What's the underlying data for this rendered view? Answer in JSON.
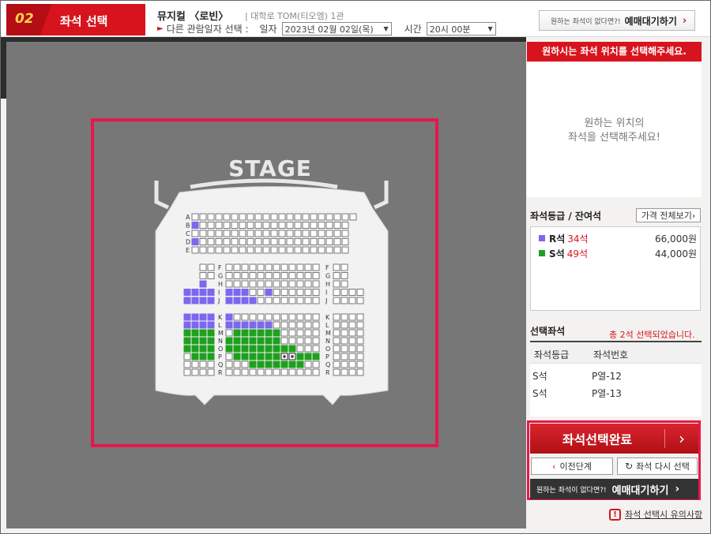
{
  "header": {
    "step_number": "02",
    "step_title": "좌석 선택",
    "show_title": "뮤지컬 〈로빈〉",
    "venue": "| 대학로 TOM(티오엠) 1관",
    "alt_date_label": "다른 관람일자 선택 :",
    "date_label": "일자",
    "date_value": "2023년 02월 02일(목)",
    "time_label": "시간",
    "time_value": "20시 00분",
    "wait_button_small": "원하는 좌석이 없다면?!",
    "wait_button_label": "예매대기하기"
  },
  "map": {
    "stage_label": "STAGE",
    "row_labels_top": [
      "A",
      "B",
      "C",
      "D",
      "E"
    ],
    "row_labels_mid": [
      "F",
      "G",
      "H",
      "I",
      "J"
    ],
    "row_labels_low": [
      "K",
      "L",
      "M",
      "N",
      "O",
      "P",
      "Q",
      "R"
    ],
    "colors": {
      "background": "#777777",
      "hall": "#f2f2f2",
      "empty_seat": "#ffffff",
      "r_seat": "#7b68ee",
      "s_seat": "#1ea01e",
      "highlight": "#e6174b"
    }
  },
  "right_panel": {
    "notice": "원하시는 좌석 위치를 선택해주세요.",
    "pick_message_line1": "원하는 위치의",
    "pick_message_line2": "좌석을 선택해주세요!",
    "grade_title": "좌석등급 / 잔여석",
    "price_view_button": "가격 전체보기",
    "grades": [
      {
        "name": "R석",
        "left": "34석",
        "price": "66,000원",
        "color": "#7b68ee"
      },
      {
        "name": "S석",
        "left": "49석",
        "price": "44,000원",
        "color": "#1ea01e"
      }
    ],
    "selected_title": "선택좌석",
    "selected_count": "총 2석 선택되었습니다.",
    "selected_header": {
      "grade": "좌석등급",
      "seat": "좌석번호"
    },
    "selected_rows": [
      {
        "grade": "S석",
        "seat": "P열-12"
      },
      {
        "grade": "S석",
        "seat": "P열-13"
      }
    ],
    "complete_button": "좌석선택완료",
    "prev_button": "이전단계",
    "reselect_button": "좌석 다시 선택",
    "wait_small": "원하는 좌석이 없다면?!",
    "wait_label": "예매대기하기",
    "caution_link": "좌석 선택시 유의사항"
  }
}
